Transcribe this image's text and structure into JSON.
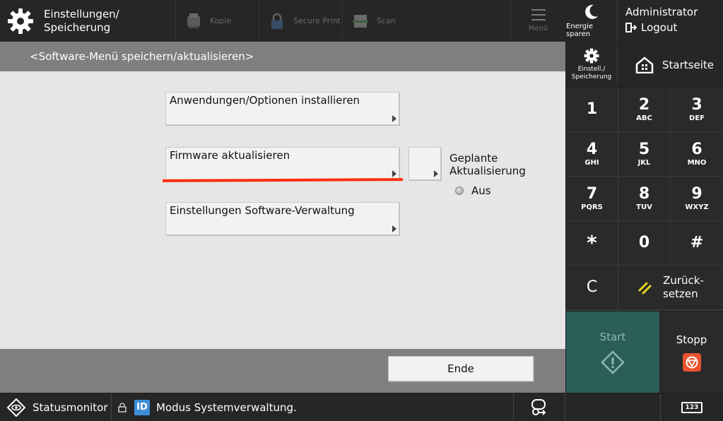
{
  "header": {
    "title": "Einstellungen/\nSpeicherung",
    "apps": [
      {
        "label": "Kopie",
        "icon": "copy-icon"
      },
      {
        "label": "Secure Print",
        "icon": "lock-icon"
      },
      {
        "label": "Scan",
        "icon": "scan-icon"
      }
    ],
    "menu_label": "Menü"
  },
  "side": {
    "energy_label": "Energie sparen",
    "user_name": "Administrator",
    "logout_label": "Logout",
    "settings_label": "Einstell./\nSpeicherung",
    "home_label": "Startseite"
  },
  "keypad": {
    "keys": [
      {
        "n": "1",
        "s": ""
      },
      {
        "n": "2",
        "s": "ABC"
      },
      {
        "n": "3",
        "s": "DEF"
      },
      {
        "n": "4",
        "s": "GHI"
      },
      {
        "n": "5",
        "s": "JKL"
      },
      {
        "n": "6",
        "s": "MNO"
      },
      {
        "n": "7",
        "s": "PQRS"
      },
      {
        "n": "8",
        "s": "TUV"
      },
      {
        "n": "9",
        "s": "WXYZ"
      },
      {
        "n": "*",
        "s": ""
      },
      {
        "n": "0",
        "s": ""
      },
      {
        "n": "#",
        "s": ""
      }
    ],
    "clear_label": "C",
    "reset_label": "Zurück-\nsetzen",
    "start_label": "Start",
    "stop_label": "Stopp"
  },
  "main": {
    "breadcrumb": "<Software-Menü speichern/aktualisieren>",
    "items": [
      {
        "label": "Anwendungen/Optionen installieren"
      },
      {
        "label": "Firmware aktualisieren"
      },
      {
        "label": "Einstellungen Software-Verwaltung"
      }
    ],
    "schedule_label": "Geplante\nAktualisierung",
    "schedule_status": "Aus",
    "end_label": "Ende"
  },
  "status": {
    "monitor_label": "Statusmonitor",
    "id_badge": "ID",
    "message": "Modus Systemverwaltung.",
    "keypad_badge": "123"
  },
  "colors": {
    "accent_underline": "#ff2d10",
    "start_button": "#2c5e58",
    "stop_icon": "#e8532d",
    "id_badge": "#3c8fd6"
  }
}
